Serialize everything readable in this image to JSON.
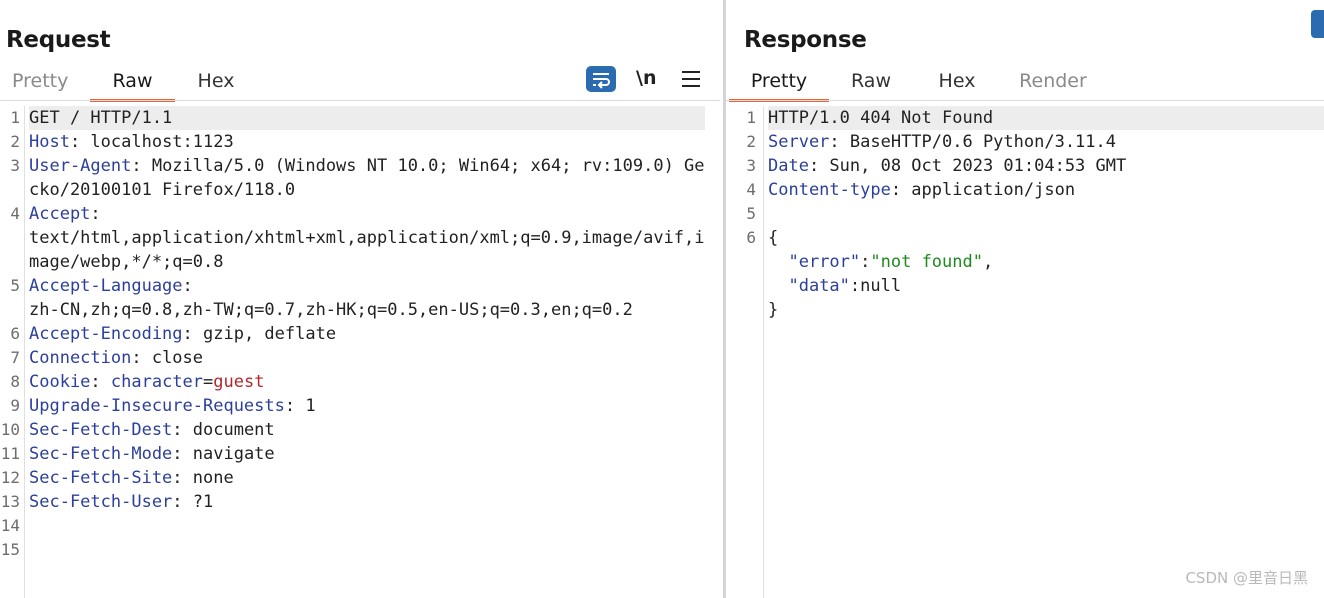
{
  "request": {
    "title": "Request",
    "tabs": [
      "Pretty",
      "Raw",
      "Hex"
    ],
    "active_tab": "Raw",
    "newline_toggle": "\\n",
    "lines": [
      {
        "n": "1",
        "parts": [
          [
            "GET / HTTP/1.1",
            "plain"
          ]
        ]
      },
      {
        "n": "2",
        "parts": [
          [
            "Host",
            "key"
          ],
          [
            ": localhost:1123",
            "plain"
          ]
        ]
      },
      {
        "n": "3",
        "parts": [
          [
            "User-Agent",
            "key"
          ],
          [
            ": Mozilla/5.0 (Windows NT 10.0; Win64; x64; rv:109.0) Gecko/20100101 Firefox/118.0",
            "plain"
          ]
        ]
      },
      {
        "n": "4",
        "parts": [
          [
            "Accept",
            "key"
          ],
          [
            ":\ntext/html,application/xhtml+xml,application/xml;q=0.9,image/avif,image/webp,*/*;q=0.8",
            "plain"
          ]
        ]
      },
      {
        "n": "5",
        "parts": [
          [
            "Accept-Language",
            "key"
          ],
          [
            ":\nzh-CN,zh;q=0.8,zh-TW;q=0.7,zh-HK;q=0.5,en-US;q=0.3,en;q=0.2",
            "plain"
          ]
        ]
      },
      {
        "n": "6",
        "parts": [
          [
            "Accept-Encoding",
            "key"
          ],
          [
            ": gzip, deflate",
            "plain"
          ]
        ]
      },
      {
        "n": "7",
        "parts": [
          [
            "Connection",
            "key"
          ],
          [
            ": close",
            "plain"
          ]
        ]
      },
      {
        "n": "8",
        "parts": [
          [
            "Cookie",
            "key"
          ],
          [
            ": ",
            "plain"
          ],
          [
            "character",
            "ckey"
          ],
          [
            "=",
            "plain"
          ],
          [
            "guest",
            "cval"
          ]
        ]
      },
      {
        "n": "9",
        "parts": [
          [
            "Upgrade-Insecure-Requests",
            "key"
          ],
          [
            ": 1",
            "plain"
          ]
        ]
      },
      {
        "n": "10",
        "parts": [
          [
            "Sec-Fetch-Dest",
            "key"
          ],
          [
            ": document",
            "plain"
          ]
        ]
      },
      {
        "n": "11",
        "parts": [
          [
            "Sec-Fetch-Mode",
            "key"
          ],
          [
            ": navigate",
            "plain"
          ]
        ]
      },
      {
        "n": "12",
        "parts": [
          [
            "Sec-Fetch-Site",
            "key"
          ],
          [
            ": none",
            "plain"
          ]
        ]
      },
      {
        "n": "13",
        "parts": [
          [
            "Sec-Fetch-User",
            "key"
          ],
          [
            ": ?1",
            "plain"
          ]
        ]
      },
      {
        "n": "14",
        "parts": []
      },
      {
        "n": "15",
        "parts": []
      }
    ]
  },
  "response": {
    "title": "Response",
    "tabs": [
      "Pretty",
      "Raw",
      "Hex",
      "Render"
    ],
    "active_tab": "Pretty",
    "lines": [
      {
        "n": "1",
        "parts": [
          [
            "HTTP/1.0 404 Not Found",
            "plain"
          ]
        ]
      },
      {
        "n": "2",
        "parts": [
          [
            "Server",
            "key"
          ],
          [
            ": BaseHTTP/0.6 Python/3.11.4",
            "plain"
          ]
        ]
      },
      {
        "n": "3",
        "parts": [
          [
            "Date",
            "key"
          ],
          [
            ": Sun, 08 Oct 2023 01:04:53 GMT",
            "plain"
          ]
        ]
      },
      {
        "n": "4",
        "parts": [
          [
            "Content-type",
            "key"
          ],
          [
            ": application/json",
            "plain"
          ]
        ]
      },
      {
        "n": "5",
        "parts": []
      },
      {
        "n": "6",
        "parts": [
          [
            "{\n  ",
            "plain"
          ],
          [
            "\"error\"",
            "jkey"
          ],
          [
            ":",
            "plain"
          ],
          [
            "\"not found\"",
            "jstr"
          ],
          [
            ",\n  ",
            "plain"
          ],
          [
            "\"data\"",
            "jkey"
          ],
          [
            ":null\n}",
            "plain"
          ]
        ]
      }
    ]
  },
  "watermark": "CSDN @里音日黑",
  "colors": {
    "accent_tab_underline": "#e2673b",
    "header_key": "#2c3f9d",
    "cookie_value": "#b2272b",
    "json_string": "#1e8a1e",
    "wrap_button": "#2b6cb0"
  },
  "icons": {
    "wrap_button": "text-wrap-icon",
    "menu_button": "hamburger-menu-icon"
  }
}
